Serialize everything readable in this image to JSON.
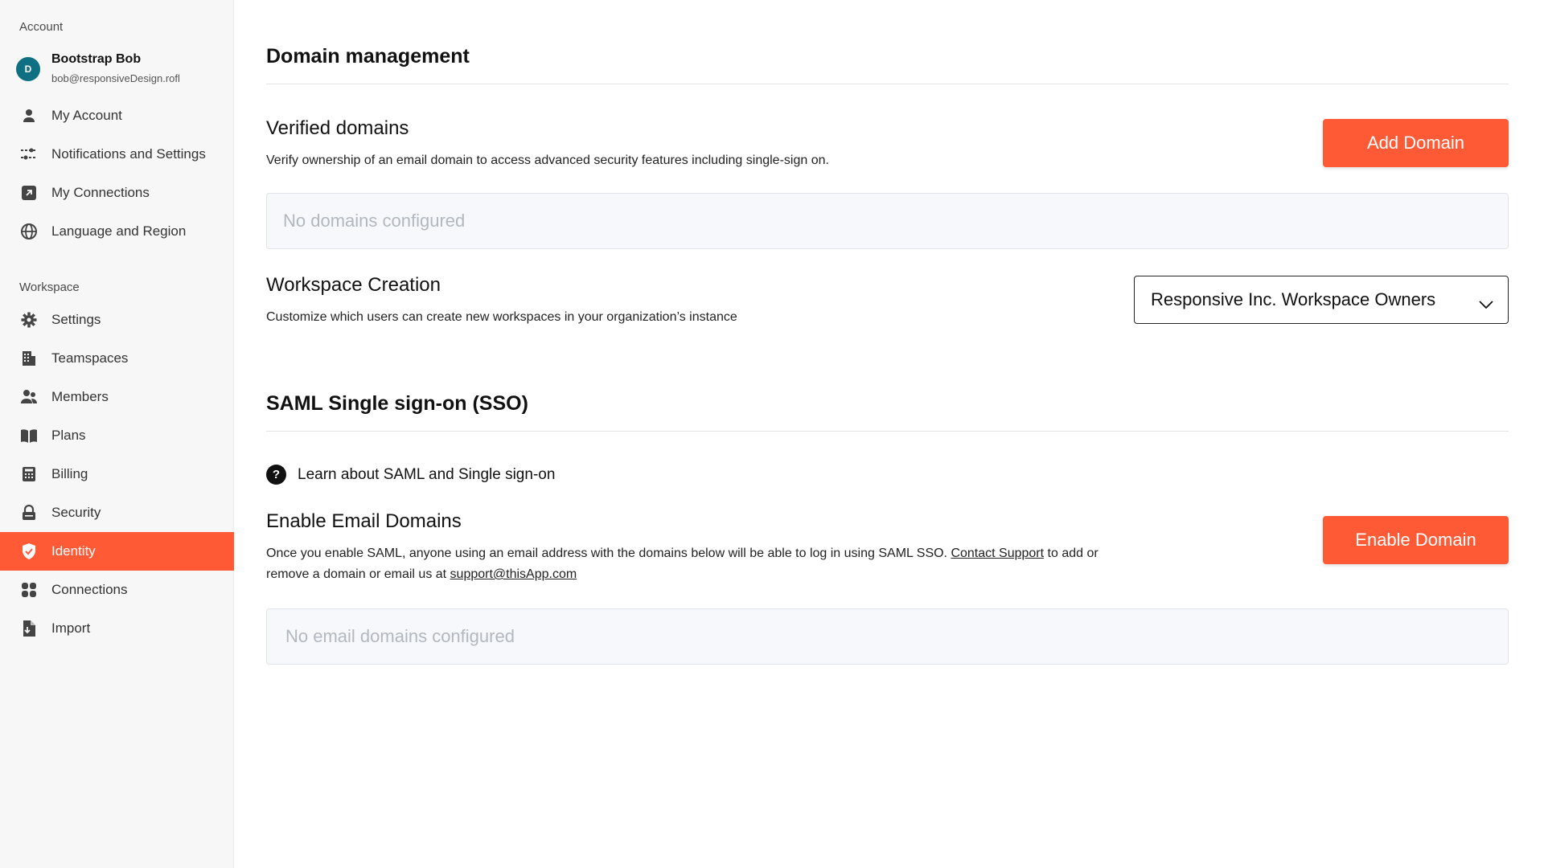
{
  "sidebar": {
    "account_label": "Account",
    "user": {
      "initial": "D",
      "name": "Bootstrap Bob",
      "email": "bob@responsiveDesign.rofl"
    },
    "account_items": [
      {
        "label": "My Account",
        "icon": "person-icon"
      },
      {
        "label": "Notifications and Settings",
        "icon": "sliders-icon"
      },
      {
        "label": "My Connections",
        "icon": "arrow-box-icon"
      },
      {
        "label": "Language and Region",
        "icon": "globe-icon"
      }
    ],
    "workspace_label": "Workspace",
    "workspace_items": [
      {
        "label": "Settings",
        "icon": "gear-icon"
      },
      {
        "label": "Teamspaces",
        "icon": "building-icon"
      },
      {
        "label": "Members",
        "icon": "members-icon"
      },
      {
        "label": "Plans",
        "icon": "book-icon"
      },
      {
        "label": "Billing",
        "icon": "calculator-icon"
      },
      {
        "label": "Security",
        "icon": "lock-icon"
      },
      {
        "label": "Identity",
        "icon": "shield-icon",
        "active": true
      },
      {
        "label": "Connections",
        "icon": "grid-icon"
      },
      {
        "label": "Import",
        "icon": "import-file-icon"
      }
    ]
  },
  "main": {
    "domain_management": {
      "title": "Domain management"
    },
    "verified_domains": {
      "title": "Verified domains",
      "description": "Verify ownership of an email domain to access advanced security features including single-sign on.",
      "button_label": "Add Domain",
      "empty_text": "No domains configured"
    },
    "workspace_creation": {
      "title": "Workspace Creation",
      "description": "Customize which users can create new workspaces in your organization’s instance",
      "selected_value": "Responsive Inc. Workspace Owners"
    },
    "saml": {
      "title": "SAML Single sign-on (SSO)",
      "help_link": "Learn about SAML and Single sign-on"
    },
    "email_domains": {
      "title": "Enable Email Domains",
      "desc_part1": "Once you enable SAML, anyone using an email address with the domains below  will be  able to log in using SAML SSO. ",
      "contact_link": "Contact Support",
      "desc_part2": " to add or",
      "desc_part3": "remove a domain or email us at ",
      "email_link": "support@thisApp.com",
      "button_label": "Enable Domain",
      "empty_text": "No email domains configured"
    }
  },
  "colors": {
    "accent": "#ff5a36",
    "avatar": "#0f6f83",
    "sidebar_bg": "#f7f7f7",
    "empty_box_bg": "#f6f8fb"
  }
}
